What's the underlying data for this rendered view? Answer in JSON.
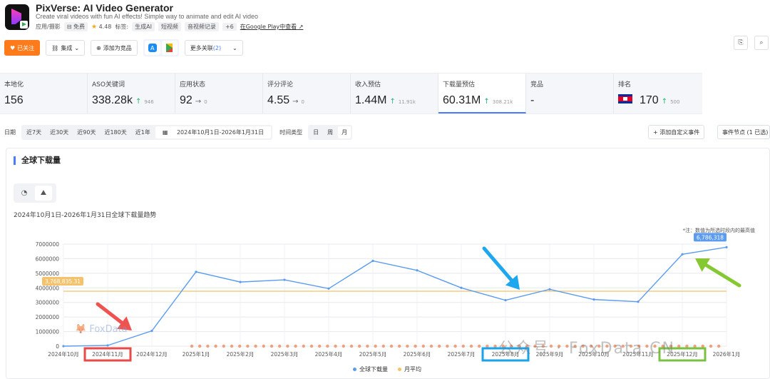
{
  "app": {
    "title": "PixVerse: AI Video Generator",
    "subtitle": "Create viral videos with fun AI effects! Simple way to animate and edit AI video",
    "category": "应用/摄影",
    "price": "免费",
    "rating": "4.48",
    "tags_label": "标签:",
    "tags": [
      "生成AI",
      "短视频",
      "音视频记录",
      "+6"
    ],
    "store_link": "在Google Play中查看"
  },
  "actions": {
    "follow": "已关注",
    "integrate": "集成",
    "add_competitor": "添加为竞品",
    "more_related": "更多关联",
    "more_related_count": "(2)"
  },
  "metrics": [
    {
      "label": "本地化",
      "value": "156",
      "trend": "",
      "change": ""
    },
    {
      "label": "ASO关键词",
      "value": "338.28k",
      "trend": "up",
      "change": "946"
    },
    {
      "label": "应用状态",
      "value": "92",
      "trend": "flat",
      "change": "0"
    },
    {
      "label": "评分评论",
      "value": "4.55",
      "trend": "flat",
      "change": "0"
    },
    {
      "label": "收入预估",
      "value": "1.44M",
      "trend": "up",
      "change": "11.91k"
    },
    {
      "label": "下载量预估",
      "value": "60.31M",
      "trend": "up",
      "change": "308.21k"
    },
    {
      "label": "竞品",
      "value": "-",
      "trend": "",
      "change": ""
    },
    {
      "label": "排名",
      "value": "170",
      "trend": "up",
      "change": "500"
    }
  ],
  "filters": {
    "date_label": "日期",
    "ranges": [
      "近7天",
      "近30天",
      "近90天",
      "近180天",
      "近1年"
    ],
    "date_range": "2024年10月1日-2026年1月31日",
    "time_type_label": "时间类型",
    "time_types": [
      "日",
      "周",
      "月"
    ],
    "selected_time_type": "月",
    "add_event": "添加自定义事件",
    "event_nodes": "事件节点 (1 已选)"
  },
  "chart_card": {
    "title": "全球下载量",
    "caption": "2024年10月1日-2026年1月31日全球下载量趋势",
    "note": "*注：数值为所选时段内的最高值",
    "avg_label": "3,768,835.31",
    "max_label": "6,786,318",
    "watermark": "公众号 · FoxData CN",
    "fox_logo": "FoxData"
  },
  "chart_data": {
    "type": "line",
    "x": [
      "2024年10月",
      "2024年11月",
      "2024年12月",
      "2025年1月",
      "2025年2月",
      "2025年3月",
      "2025年4月",
      "2025年5月",
      "2025年6月",
      "2025年7月",
      "2025年8月",
      "2025年9月",
      "2025年10月",
      "2025年11月",
      "2025年12月",
      "2026年1月"
    ],
    "series": [
      {
        "name": "全球下载量",
        "color": "#5b9bf0",
        "values": [
          0,
          50000,
          1050000,
          5100000,
          4400000,
          4550000,
          3950000,
          5850000,
          5200000,
          4000000,
          3150000,
          3900000,
          3200000,
          3050000,
          6300000,
          6786318
        ]
      },
      {
        "name": "月平均",
        "color": "#f5c26b",
        "values": [
          3768835.31,
          3768835.31,
          3768835.31,
          3768835.31,
          3768835.31,
          3768835.31,
          3768835.31,
          3768835.31,
          3768835.31,
          3768835.31,
          3768835.31,
          3768835.31,
          3768835.31,
          3768835.31,
          3768835.31,
          3768835.31
        ]
      }
    ],
    "y_ticks": [
      "0",
      "1000000",
      "2000000",
      "3000000",
      "4000000",
      "5000000",
      "6000000",
      "7000000"
    ],
    "ylim": [
      0,
      7000000
    ],
    "grid": true,
    "legend": "bottom-center"
  },
  "annotations": {
    "highlight_boxes": [
      {
        "label": "2024年11月",
        "color": "#e84a4a"
      },
      {
        "label": "2025年8月",
        "color": "#1aa3e8"
      },
      {
        "label": "2025年12月",
        "color": "#7ac142"
      }
    ]
  }
}
